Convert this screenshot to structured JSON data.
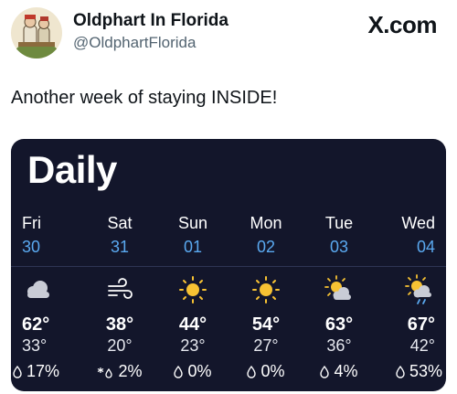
{
  "post": {
    "author_name": "Oldphart In Florida",
    "author_handle": "@OldphartFlorida",
    "brand": "X.com",
    "text": "Another week of staying INSIDE!"
  },
  "weather": {
    "title": "Daily",
    "days": [
      {
        "name": "Fri",
        "date": "30",
        "icon": "cloudy-icon",
        "high": "62°",
        "low": "33°",
        "precip": "17%",
        "precip_icon": "raindrop-icon"
      },
      {
        "name": "Sat",
        "date": "31",
        "icon": "wind-icon",
        "high": "38°",
        "low": "20°",
        "precip": "2%",
        "precip_icon": "snowflake-drop-icon"
      },
      {
        "name": "Sun",
        "date": "01",
        "icon": "sunny-icon",
        "high": "44°",
        "low": "23°",
        "precip": "0%",
        "precip_icon": "raindrop-icon"
      },
      {
        "name": "Mon",
        "date": "02",
        "icon": "sunny-icon",
        "high": "54°",
        "low": "27°",
        "precip": "0%",
        "precip_icon": "raindrop-icon"
      },
      {
        "name": "Tue",
        "date": "03",
        "icon": "partly-cloudy-icon",
        "high": "63°",
        "low": "36°",
        "precip": "4%",
        "precip_icon": "raindrop-icon"
      },
      {
        "name": "Wed",
        "date": "04",
        "icon": "sun-cloud-rain-icon",
        "high": "67°",
        "low": "42°",
        "precip": "53%",
        "precip_icon": "raindrop-icon"
      }
    ],
    "colors": {
      "background": "#13162b",
      "date": "#5aa9f0",
      "sun": "#f7c233",
      "cloud": "#c9ccd6"
    }
  }
}
